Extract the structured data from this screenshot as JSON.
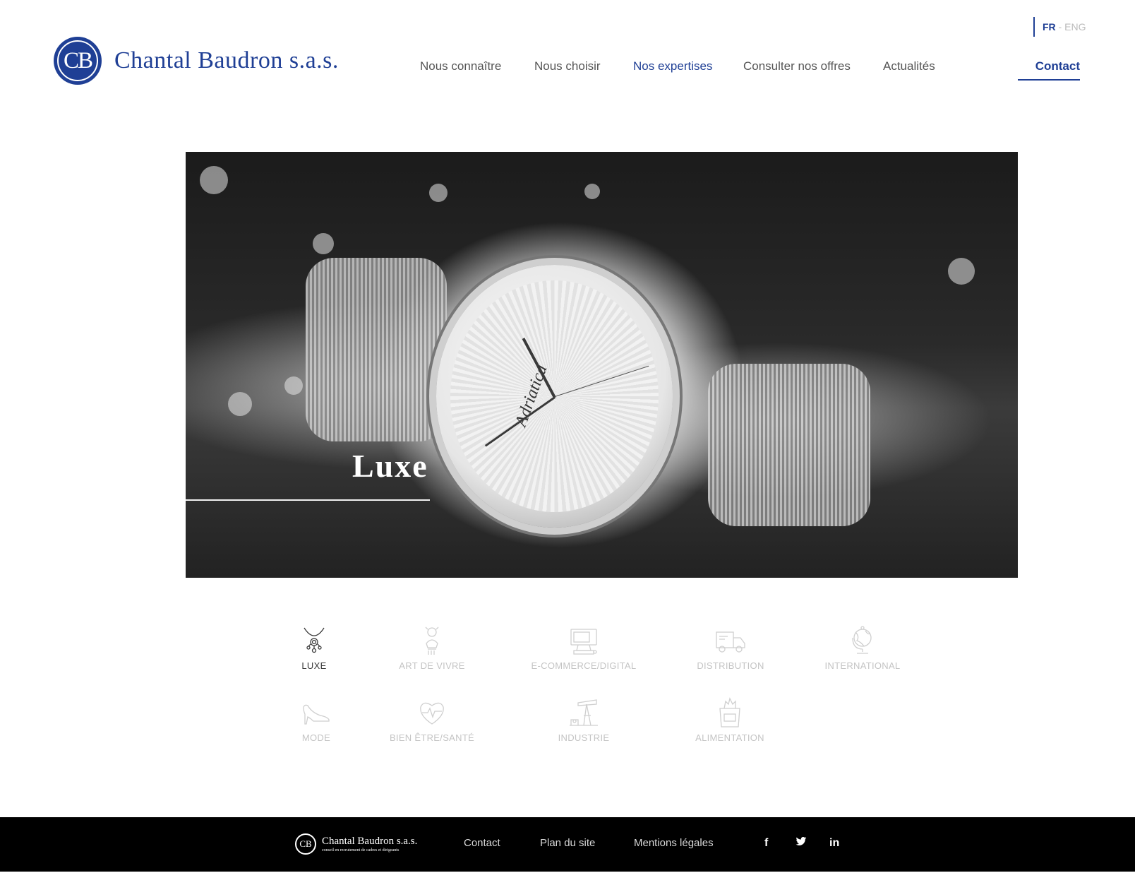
{
  "brand": {
    "badge": "CB",
    "name": "Chantal Baudron s.a.s."
  },
  "language": {
    "active": "FR",
    "separator": " - ",
    "other": "ENG"
  },
  "nav": {
    "items": [
      "Nous connaître",
      "Nous choisir",
      "Nos expertises",
      "Consulter nos offres",
      "Actualités"
    ],
    "active": "Nos expertises",
    "contact": "Contact"
  },
  "hero": {
    "title": "Luxe",
    "watch_brand": "Adriatica"
  },
  "categories": [
    {
      "label": "LUXE",
      "icon": "necklace-icon",
      "active": true
    },
    {
      "label": "ART DE VIVRE",
      "icon": "art-bust-icon",
      "active": false
    },
    {
      "label": "E-COMMERCE/DIGITAL",
      "icon": "computer-icon",
      "active": false
    },
    {
      "label": "DISTRIBUTION",
      "icon": "truck-icon",
      "active": false
    },
    {
      "label": "INTERNATIONAL",
      "icon": "globe-icon",
      "active": false
    },
    {
      "label": "MODE",
      "icon": "high-heel-icon",
      "active": false
    },
    {
      "label": "BIEN ÊTRE/SANTÉ",
      "icon": "heart-pulse-icon",
      "active": false
    },
    {
      "label": "INDUSTRIE",
      "icon": "oil-pump-icon",
      "active": false
    },
    {
      "label": "ALIMENTATION",
      "icon": "grocery-bag-icon",
      "active": false
    }
  ],
  "footer": {
    "badge": "CB",
    "name": "Chantal Baudron s.a.s.",
    "tagline": "conseil en recrutement de cadres et dirigeants",
    "links": [
      "Contact",
      "Plan du site",
      "Mentions légales"
    ],
    "social": {
      "facebook": "f",
      "twitter": "🐦",
      "linkedin": "in"
    }
  },
  "colors": {
    "accent": "#1f3f95",
    "inactive_category": "#c4c4c4",
    "footer_bg": "#000000"
  }
}
